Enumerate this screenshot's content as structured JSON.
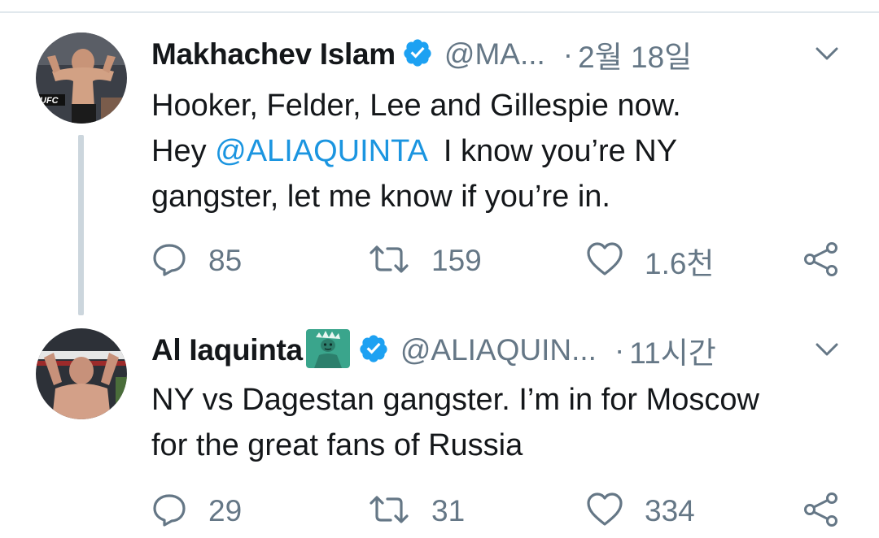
{
  "tweets": [
    {
      "name": "Makhachev Islam",
      "handle": "@MA...",
      "dot": "·",
      "time": "2월 18일",
      "text_lines": [
        "Hooker, Felder, Lee and Gillespie now."
      ],
      "text_prefix": "Hey ",
      "mention": "@ALIAQUINTA",
      "text_suffix": "  I know you’re NY",
      "text_line3": "gangster, let me know if you’re in.",
      "replies": "85",
      "retweets": "159",
      "likes": "1.6천",
      "avatar_text": "UFC"
    },
    {
      "name": "Al Iaquinta",
      "emoji_icon": "statue-of-liberty-emoji",
      "handle": "@ALIAQUIN...",
      "dot": "·",
      "time": "11시간",
      "text_line1": "NY vs Dagestan gangster. I’m in for Moscow",
      "text_line2": "for the great fans of Russia",
      "replies": "29",
      "retweets": "31",
      "likes": "334"
    }
  ],
  "icons": {
    "verified": "verified-badge-icon",
    "chevron": "chevron-down-icon",
    "reply": "reply-icon",
    "retweet": "retweet-icon",
    "like": "heart-icon",
    "share": "share-icon"
  },
  "colors": {
    "text": "#14171a",
    "secondary": "#657786",
    "mention": "#1b95e0",
    "verified": "#1da1f2",
    "statue": "#3aa58c",
    "divider": "#e1e8ed",
    "thread_line": "#ccd6dd"
  }
}
